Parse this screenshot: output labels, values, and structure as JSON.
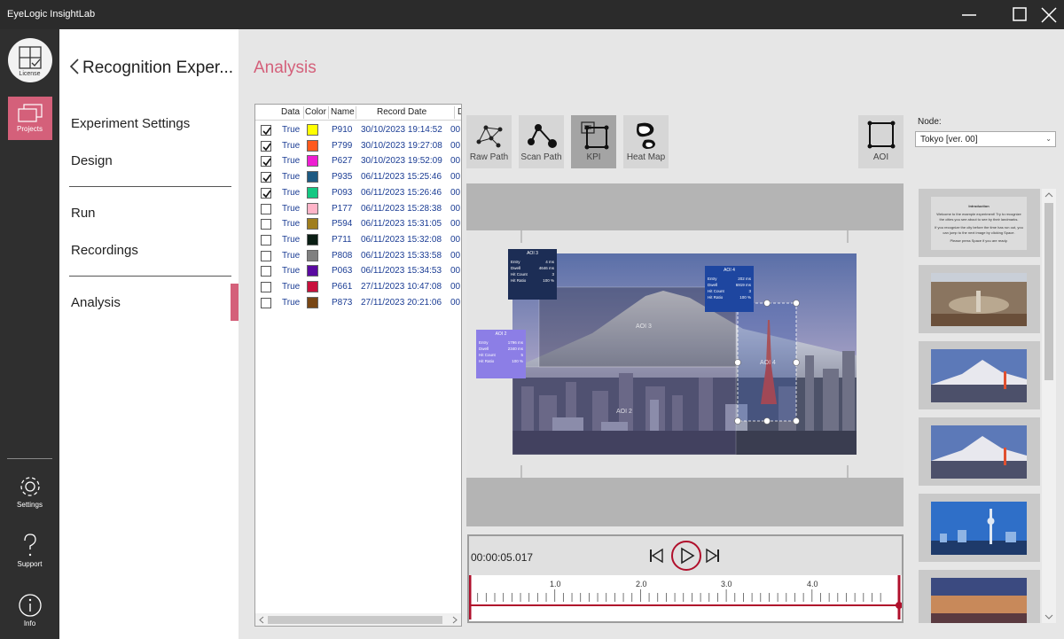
{
  "app": {
    "title": "EyeLogic InsightLab"
  },
  "rail": {
    "license": "License",
    "projects": "Projects",
    "settings": "Settings",
    "support": "Support",
    "info": "Info"
  },
  "nav": {
    "title": "Recognition Exper...",
    "items": [
      "Experiment Settings",
      "Design",
      "Run",
      "Recordings",
      "Analysis"
    ],
    "active": "Analysis"
  },
  "main": {
    "title": "Analysis"
  },
  "table": {
    "columns": [
      "Data",
      "Color",
      "Name",
      "Record Date",
      "D"
    ],
    "rows": [
      {
        "checked": true,
        "data": "True",
        "color": "#ffff00",
        "name": "P910",
        "date": "30/10/2023 19:14:52",
        "d": "00:"
      },
      {
        "checked": true,
        "data": "True",
        "color": "#ff5a1e",
        "name": "P799",
        "date": "30/10/2023 19:27:08",
        "d": "00:"
      },
      {
        "checked": true,
        "data": "True",
        "color": "#ee1ed2",
        "name": "P627",
        "date": "30/10/2023 19:52:09",
        "d": "00:"
      },
      {
        "checked": true,
        "data": "True",
        "color": "#1e5a82",
        "name": "P935",
        "date": "06/11/2023 15:25:46",
        "d": "00:"
      },
      {
        "checked": true,
        "data": "True",
        "color": "#14c882",
        "name": "P093",
        "date": "06/11/2023 15:26:46",
        "d": "00:"
      },
      {
        "checked": false,
        "data": "True",
        "color": "#ffb4c8",
        "name": "P177",
        "date": "06/11/2023 15:28:38",
        "d": "00:"
      },
      {
        "checked": false,
        "data": "True",
        "color": "#a07e1e",
        "name": "P594",
        "date": "06/11/2023 15:31:05",
        "d": "00:"
      },
      {
        "checked": false,
        "data": "True",
        "color": "#0a1e14",
        "name": "P711",
        "date": "06/11/2023 15:32:08",
        "d": "00:"
      },
      {
        "checked": false,
        "data": "True",
        "color": "#808080",
        "name": "P808",
        "date": "06/11/2023 15:33:58",
        "d": "00:"
      },
      {
        "checked": false,
        "data": "True",
        "color": "#5a0aa0",
        "name": "P063",
        "date": "06/11/2023 15:34:53",
        "d": "00:"
      },
      {
        "checked": false,
        "data": "True",
        "color": "#c8103c",
        "name": "P661",
        "date": "27/11/2023 10:47:08",
        "d": "00:"
      },
      {
        "checked": false,
        "data": "True",
        "color": "#784614",
        "name": "P873",
        "date": "27/11/2023 20:21:06",
        "d": "00:"
      }
    ]
  },
  "toolbar": {
    "raw_path": "Raw Path",
    "scan_path": "Scan Path",
    "kpi": "KPI",
    "heat_map": "Heat Map",
    "aoi": "AOI",
    "active": "KPI"
  },
  "node": {
    "label": "Node:",
    "value": "Tokyo [ver. 00]"
  },
  "aois": {
    "aoi2": {
      "label": "AOI 2",
      "title": "AOI 2",
      "entry_label": "Entry",
      "entry": "1796 ms",
      "dwell_label": "Dwell",
      "dwell": "2340 ms",
      "count_label": "Hit Count",
      "count": "5",
      "ratio_label": "Hit Ratio",
      "ratio": "100 %"
    },
    "aoi3": {
      "label": "AOI 3",
      "title": "AOI 3",
      "entry_label": "Entry",
      "entry": "4 ms",
      "dwell_label": "Dwell",
      "dwell": "4646 ms",
      "count_label": "Hit Count",
      "count": "3",
      "ratio_label": "Hit Ratio",
      "ratio": "100 %"
    },
    "aoi4": {
      "label": "AOI 4",
      "title": "AOI 4",
      "entry_label": "Entry",
      "entry": "202 ms",
      "dwell_label": "Dwell",
      "dwell": "6919 ms",
      "count_label": "Hit Count",
      "count": "3",
      "ratio_label": "Hit Ratio",
      "ratio": "100 %"
    }
  },
  "colors": {
    "accent": "#d4607a",
    "aoi3": "#1c2d55",
    "aoi4": "#1e46a0",
    "aoi2": "#8c7ee6",
    "timeline": "#b0102c"
  },
  "playback": {
    "timecode": "00:00:05.017",
    "ticks": [
      "1.0",
      "2.0",
      "3.0",
      "4.0"
    ],
    "position_seconds": 5.017
  },
  "slides": {
    "intro": {
      "title": "Introduction",
      "lines": [
        "Welcome to the example experiment! Try to recognize the cities you see about to see by their landmarks.",
        "If you recognize the city before the time has run out, you can jump to the next image by clicking Space.",
        "Please press Space if you are ready."
      ]
    },
    "count": 7
  }
}
